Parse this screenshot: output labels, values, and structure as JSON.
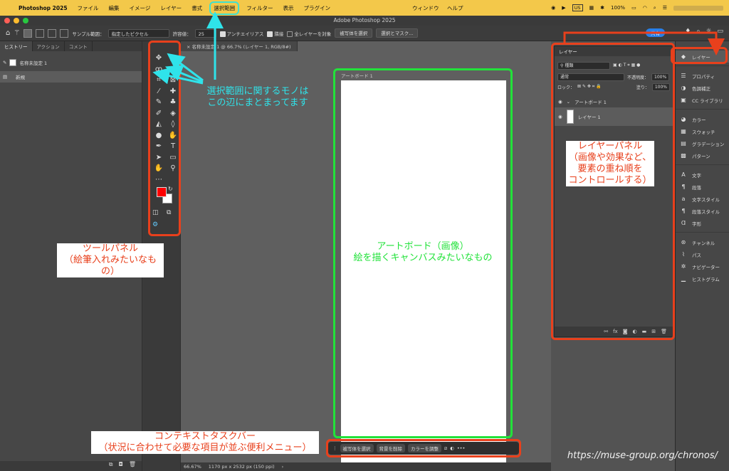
{
  "menubar": {
    "app": "Photoshop 2025",
    "items": [
      "ファイル",
      "編集",
      "イメージ",
      "レイヤー",
      "書式",
      "選択範囲",
      "フィルター",
      "表示",
      "プラグイン",
      "ウィンドウ",
      "ヘルプ"
    ],
    "right_badge": "US",
    "battery": "100%"
  },
  "window": {
    "title": "Adobe Photoshop 2025"
  },
  "options": {
    "sample_label": "サンプル範囲：",
    "sample_value": "指定したピクセル",
    "tolerance_label": "許容値：",
    "tolerance_value": "25",
    "antialias": "アンチエイリアス",
    "contiguous": "隣接",
    "all_layers": "全レイヤーを対象",
    "select_subject": "被写体を選択",
    "select_mask": "選択とマスク...",
    "share": "共有"
  },
  "history_panel": {
    "tabs": [
      "ヒストリー",
      "アクション",
      "コメント"
    ],
    "snapshot": "名称未設定 1",
    "state": "新規"
  },
  "document": {
    "tab": "名称未設定 1 @ 66.7% (レイヤー 1, RGB/8#)",
    "artboard_label": "アートボード 1",
    "zoom": "66.67%",
    "dimensions": "1170 px x 2532 px (150 ppi)"
  },
  "context_bar": {
    "select_subject": "被写体を選択",
    "remove_bg": "背景を削除",
    "adjust_color": "カラーを調整",
    "more": "•••"
  },
  "layers_panel": {
    "title": "レイヤー",
    "filter": "種類",
    "blend": "通常",
    "opacity_label": "不透明度：",
    "opacity": "100%",
    "lock_label": "ロック：",
    "fill_label": "塗り：",
    "fill": "100%",
    "group": "アートボード 1",
    "layer": "レイヤー 1"
  },
  "dock": {
    "items": [
      "レイヤー",
      "プロパティ",
      "色調補正",
      "CC ライブラリ",
      "カラー",
      "スウォッチ",
      "グラデーション",
      "パターン",
      "文字",
      "段落",
      "文字スタイル",
      "段落スタイル",
      "字形",
      "チャンネル",
      "パス",
      "ナビゲーター",
      "ヒストグラム"
    ]
  },
  "annotations": {
    "selection": [
      "選択範囲に関するモノは",
      "この辺にまとまってます"
    ],
    "tool_panel": [
      "ツールパネル",
      "（絵筆入れみたいなもの）"
    ],
    "layers_panel": [
      "レイヤーパネル",
      "（画像や効果など、",
      "要素の重ね順を",
      "コントロールする）"
    ],
    "artboard": [
      "アートボード（画像）",
      "絵を描くキャンバスみたいなもの"
    ],
    "context_bar": [
      "コンテキストタスクバー",
      "（状況に合わせて必要な項目が並ぶ便利メニュー）"
    ]
  },
  "watermark": "https://muse-group.org/chronos/",
  "colors": {
    "menubar": "#f3c84a",
    "red": "#e8401c",
    "cyan": "#2fe3ea",
    "green": "#22e23a",
    "foreground_swatch": "#ff0000"
  }
}
